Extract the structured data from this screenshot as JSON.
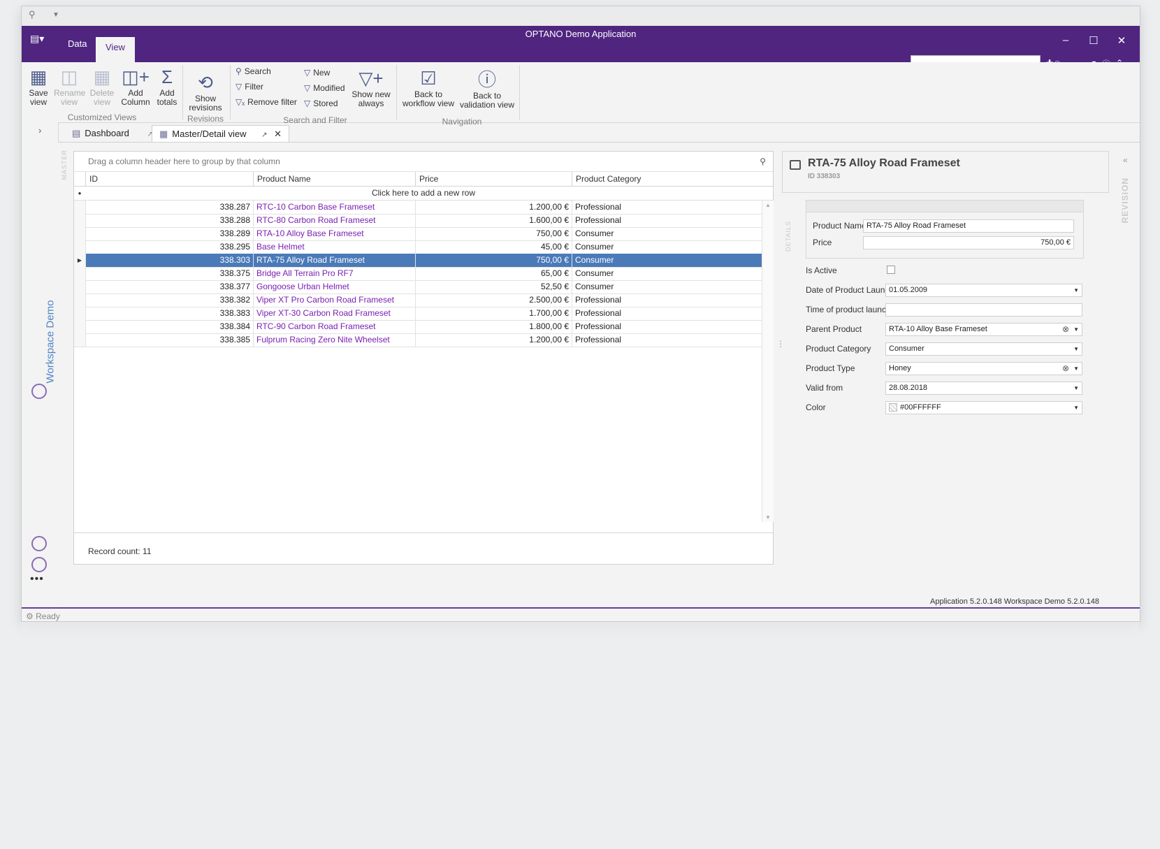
{
  "app": {
    "title": "OPTANO Demo Application",
    "accent": "#4f2580",
    "selection_color": "#4a7ab8",
    "link_color": "#7a1fb0"
  },
  "ribbon_tabs": {
    "data": "Data",
    "view": "View"
  },
  "ribbon": {
    "customized_views": {
      "label": "Customized Views",
      "save_view": "Save view",
      "rename_view": "Rename view",
      "delete_view": "Delete view",
      "add_column": "Add Column",
      "add_totals": "Add totals"
    },
    "revisions": {
      "label": "Revisions",
      "show_revisions": "Show revisions"
    },
    "search_filter": {
      "label": "Search and Filter",
      "search": "Search",
      "filter": "Filter",
      "remove_filter": "Remove filter",
      "new": "New",
      "modified": "Modified",
      "stored": "Stored",
      "show_new_always": "Show new always"
    },
    "navigation": {
      "label": "Navigation",
      "back_workflow": "Back to workflow view",
      "back_validation": "Back to validation view"
    }
  },
  "left_nav": {
    "workspace": "Workspace Demo"
  },
  "doc_tabs": {
    "dashboard": "Dashboard",
    "master_detail": "Master/Detail view"
  },
  "grid": {
    "side_label": "MASTER",
    "group_hint": "Drag a column header here to group by that column",
    "columns": [
      "ID",
      "Product Name",
      "Price",
      "Product Category"
    ],
    "new_row": "Click here to add a new row",
    "rows": [
      {
        "id": "338.287",
        "name": "RTC-10 Carbon Base Frameset",
        "price": "1.200,00 €",
        "category": "Professional"
      },
      {
        "id": "338.288",
        "name": "RTC-80 Carbon Road Frameset",
        "price": "1.600,00 €",
        "category": "Professional"
      },
      {
        "id": "338.289",
        "name": "RTA-10 Alloy Base Frameset",
        "price": "750,00 €",
        "category": "Consumer"
      },
      {
        "id": "338.295",
        "name": "Base Helmet",
        "price": "45,00 €",
        "category": "Consumer"
      },
      {
        "id": "338.303",
        "name": "RTA-75 Alloy Road Frameset",
        "price": "750,00 €",
        "category": "Consumer"
      },
      {
        "id": "338.375",
        "name": "Bridge All Terrain Pro RF7",
        "price": "65,00 €",
        "category": "Consumer"
      },
      {
        "id": "338.377",
        "name": "Gongoose Urban Helmet",
        "price": "52,50 €",
        "category": "Consumer"
      },
      {
        "id": "338.382",
        "name": "Viper XT Pro Carbon Road Frameset",
        "price": "2.500,00 €",
        "category": "Professional"
      },
      {
        "id": "338.383",
        "name": "Viper XT-30 Carbon Road Frameset",
        "price": "1.700,00 €",
        "category": "Professional"
      },
      {
        "id": "338.384",
        "name": "RTC-90 Carbon Road Frameset",
        "price": "1.800,00 €",
        "category": "Professional"
      },
      {
        "id": "338.385",
        "name": "Fulprum Racing Zero Nite Wheelset",
        "price": "1.200,00 €",
        "category": "Professional"
      }
    ],
    "selected_index": 4,
    "record_count": "Record count: 11"
  },
  "detail": {
    "title": "RTA-75 Alloy Road Frameset",
    "subtitle": "ID 338303",
    "side_label": "DETAILS",
    "revision_label": "REVISION",
    "product_name_label": "Product Name",
    "product_name": "RTA-75 Alloy Road Frameset",
    "price_label": "Price",
    "price": "750,00 €",
    "is_active_label": "Is Active",
    "launch_date_label": "Date of Product Launch",
    "launch_date": "01.05.2009",
    "launch_time_label": "Time of product launch",
    "launch_time": "",
    "parent_label": "Parent Product",
    "parent": "RTA-10 Alloy Base Frameset",
    "category_label": "Product Category",
    "category": "Consumer",
    "type_label": "Product Type",
    "type": "Honey",
    "valid_from_label": "Valid from",
    "valid_from": "28.08.2018",
    "color_label": "Color",
    "color": "#00FFFFFF"
  },
  "status": {
    "versions": "Application 5.2.0.148  Workspace Demo 5.2.0.148",
    "state": "Ready"
  }
}
